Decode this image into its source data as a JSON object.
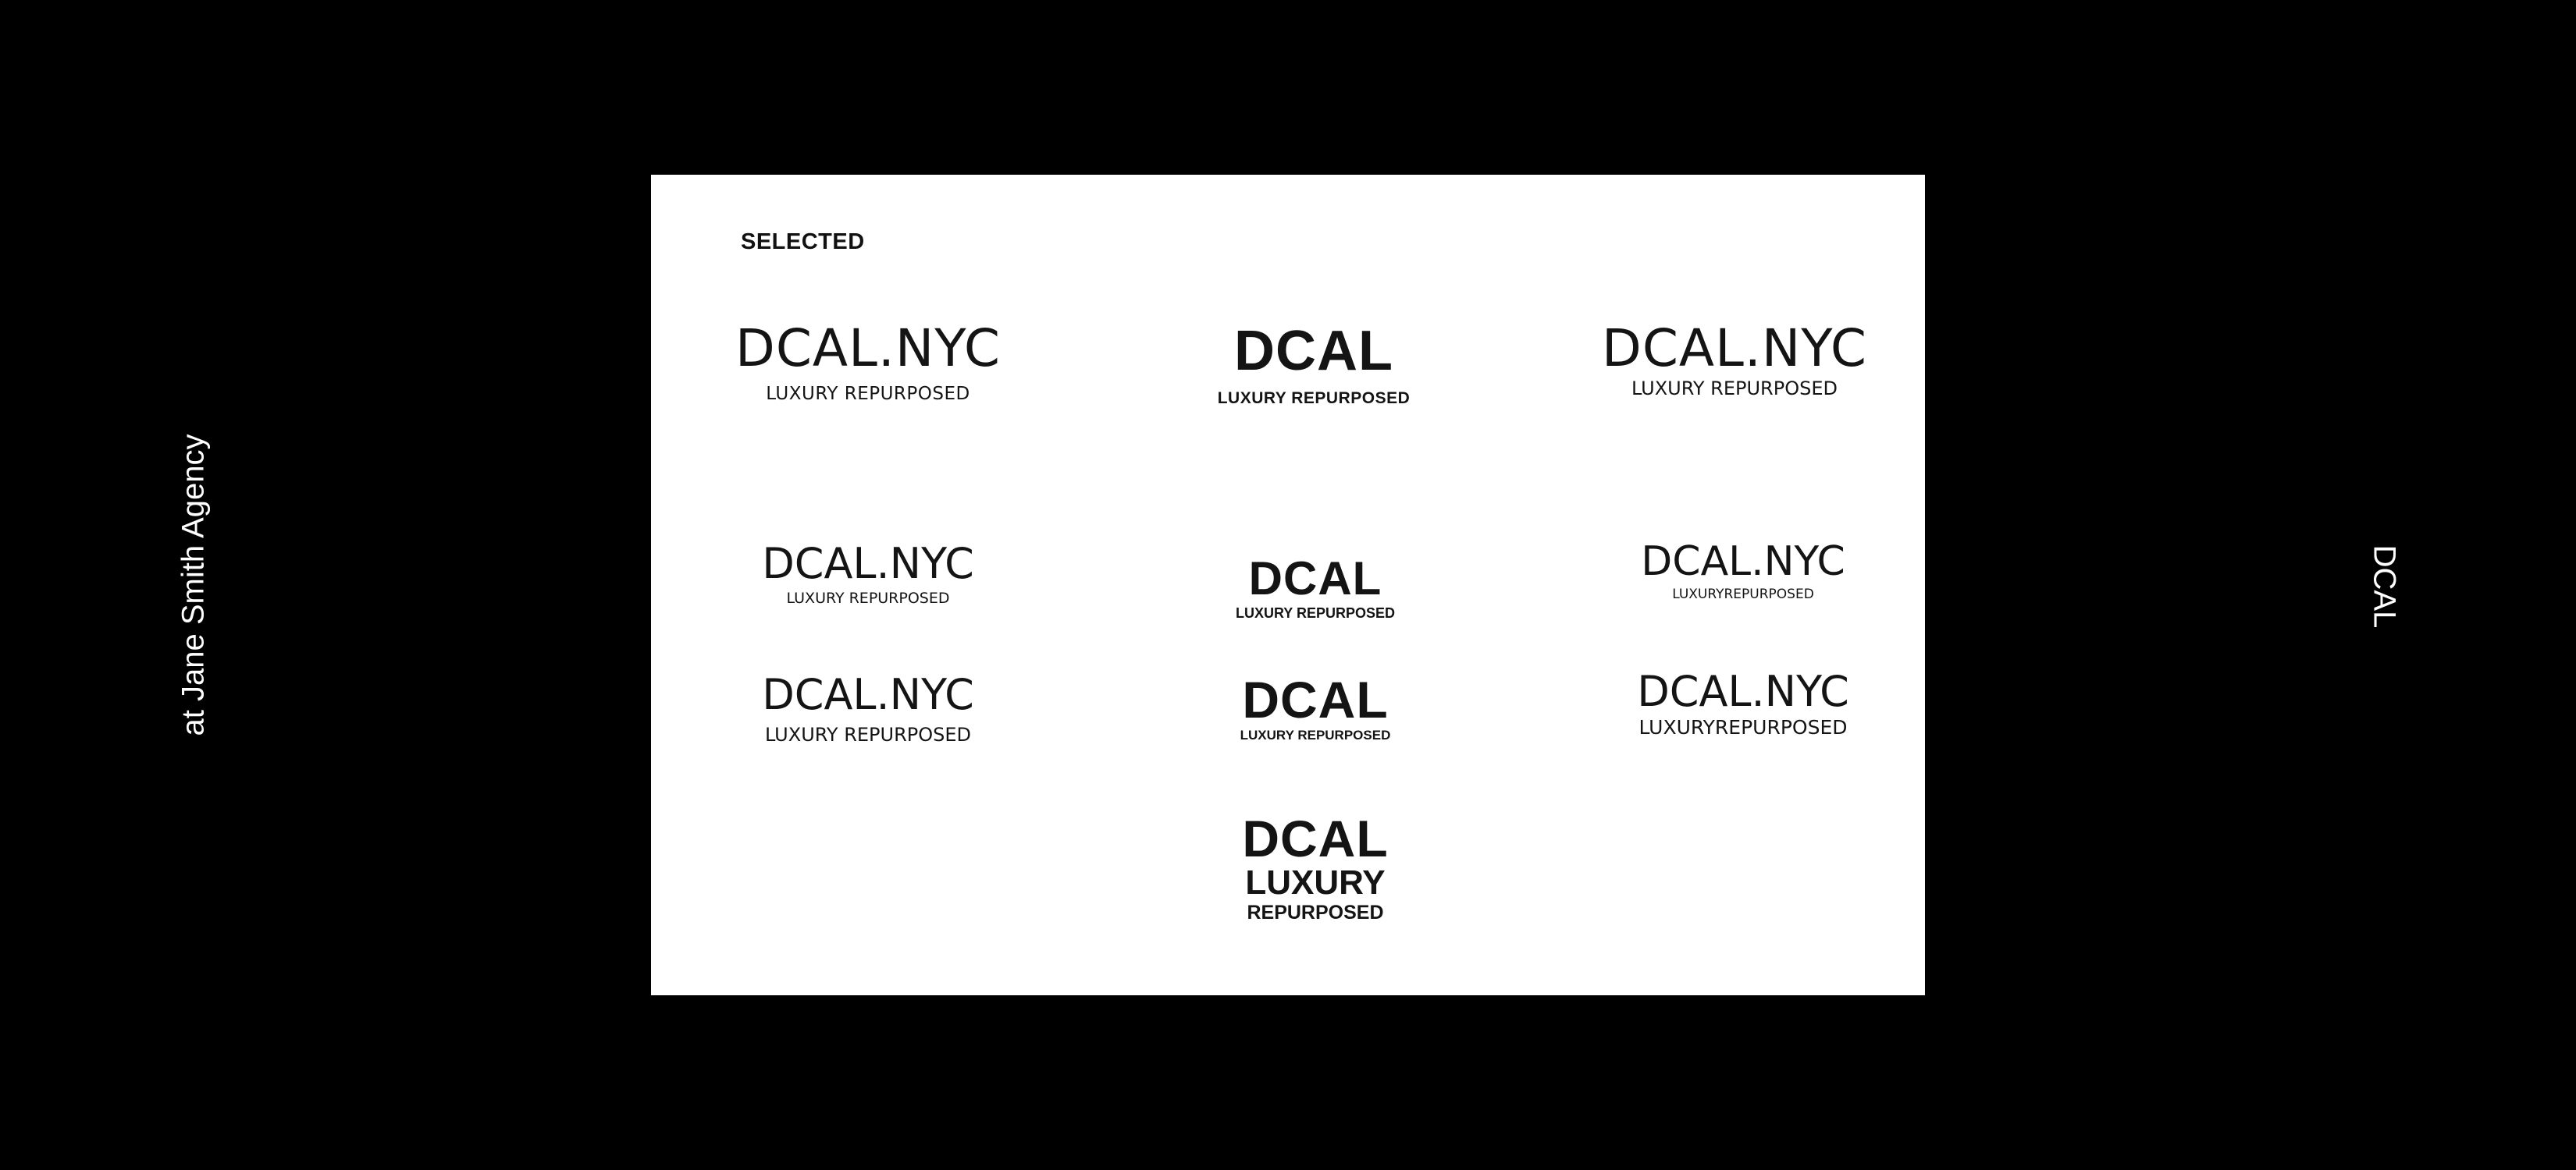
{
  "side_left_text": "at Jane Smith Agency",
  "side_right_text": "DCAL",
  "board": {
    "heading": "SELECTED",
    "logos": [
      {
        "main": "DCAL.NYC",
        "sub": "LUXURY REPURPOSED"
      },
      {
        "main": "DCAL",
        "sub": "LUXURY REPURPOSED"
      },
      {
        "main": "DCAL.NYC",
        "sub": "LUXURY REPURPOSED"
      },
      {
        "main": "DCAL.NYC",
        "sub": "LUXURY REPURPOSED"
      },
      {
        "main": "DCAL",
        "sub": "LUXURY REPURPOSED"
      },
      {
        "main": "DCAL.NYC",
        "sub": "LUXURYREPURPOSED"
      },
      {
        "main": "DCAL.NYC",
        "sub": "LUXURY REPURPOSED"
      },
      {
        "main": "DCAL",
        "sub": "LUXURY REPURPOSED"
      },
      {
        "main": "DCAL.NYC",
        "sub": "LUXURYREPURPOSED"
      },
      {
        "main": "DCAL",
        "sub": "LUXURY",
        "sub2": "REPURPOSED"
      }
    ]
  }
}
